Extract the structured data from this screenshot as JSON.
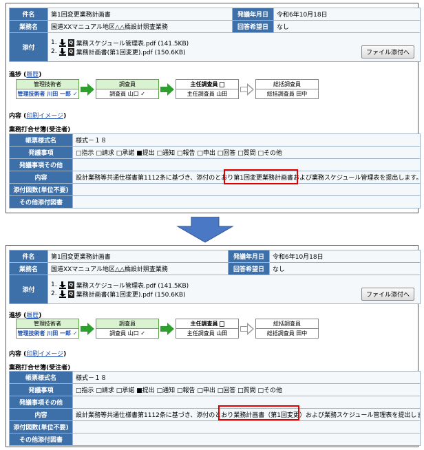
{
  "header": {
    "subject_label": "件名",
    "subject_value": "第1回変更業務計画書",
    "date_label": "発議年月日",
    "date_value": "令和6年10月18日",
    "project_label": "業務名",
    "project_value": "国道XXマニュアル地区△△橋設計照査業務",
    "reply_label": "回答希望日",
    "reply_value": "なし",
    "attach_label": "添付",
    "attachments": [
      {
        "no": "1.",
        "name": "業務スケジュール管理表.pdf (141.5KB)"
      },
      {
        "no": "2.",
        "name": "業務計画書(第1回変更).pdf (150.6KB)"
      }
    ],
    "attach_button": "ファイル添付へ",
    "download_icon": "download-icon",
    "doc_icon": "document-icon"
  },
  "progress": {
    "label": "進捗",
    "history_link": "履歴",
    "steps": [
      {
        "title": "管理技術者",
        "name": "管理技術者 川田 一郎",
        "check": "✓"
      },
      {
        "title": "調査員",
        "name": "調査員 山口",
        "check": "✓"
      },
      {
        "title": "主任調査員",
        "name": "主任調査員 山田"
      },
      {
        "title": "総括調査員",
        "name": "総括調査員 田中"
      }
    ]
  },
  "content": {
    "label": "内容",
    "print_link": "印刷イメージ",
    "section_title": "業務打合せ簿(受注者)",
    "form_label": "帳票様式名",
    "form_value": "様式－１８",
    "issue_label": "発議事項",
    "issue_options": [
      "□指示",
      "□請求",
      "□承諾",
      "■提出",
      "□通知",
      "□報告",
      "□申出",
      "□回答",
      "□質問",
      "□その他"
    ],
    "issue_other_label": "発議事項その他",
    "body_label": "内容",
    "count_label": "添付図数(単位不要)",
    "other_attach_label": "その他添付図書"
  },
  "top_body": {
    "before": "設計業務等共通仕様書第1112条に基づき、添付のとおり",
    "highlight": "第1回変更業務計画書",
    "after": "および業務スケジュール管理表を提出します。"
  },
  "bottom_body": {
    "before": "設計業務等共通仕様書第1112条に基づき、添付のとおり",
    "highlight": "業務計画書（第1回変更）",
    "after": "および業務スケジュール管理表を提出します。"
  },
  "colors": {
    "header_bg": "#3d6fa8",
    "highlight": "#e00000",
    "big_arrow": "#4a78c4",
    "done_green": "#2ea02e"
  }
}
